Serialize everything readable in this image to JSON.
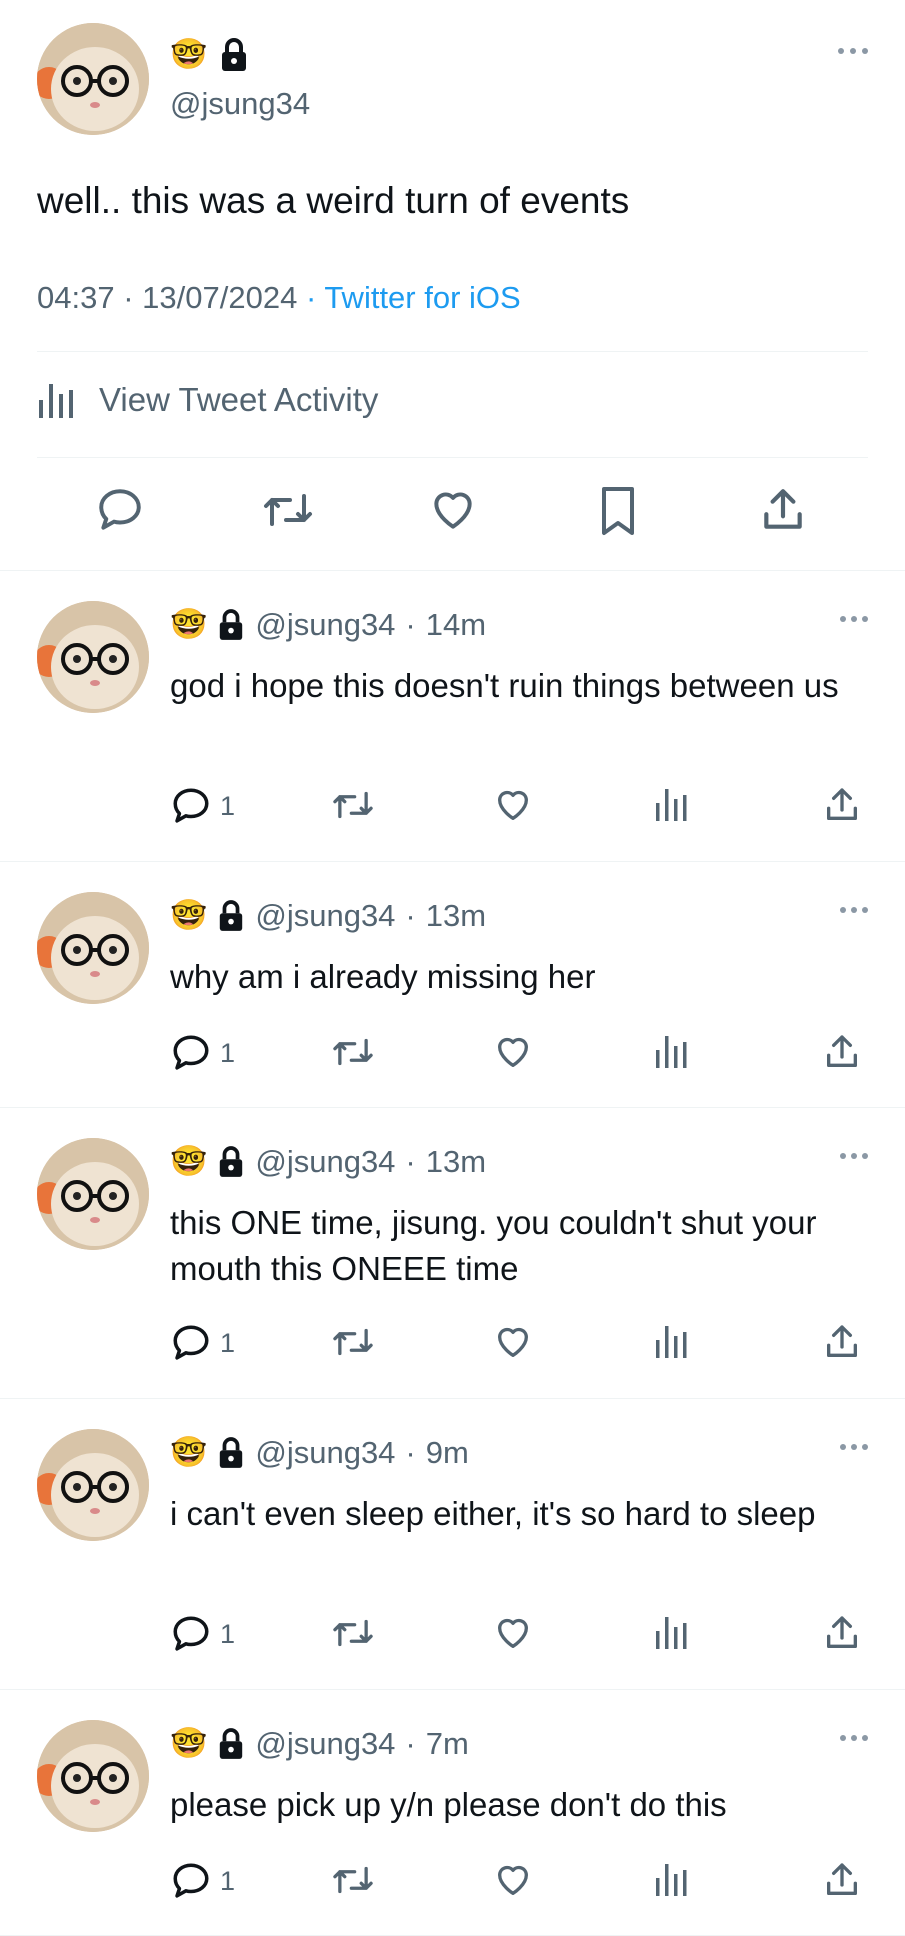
{
  "main_tweet": {
    "badges": [
      "🤓",
      "🔒"
    ],
    "handle": "@jsung34",
    "text": "well.. this was a weird turn of events",
    "time": "04:37",
    "date": "13/07/2024",
    "source": "Twitter for iOS",
    "activity_label": "View Tweet Activity"
  },
  "replies": [
    {
      "handle": "@jsung34",
      "time": "14m",
      "text": "god i hope this doesn't ruin things between us",
      "reply_count": "1"
    },
    {
      "handle": "@jsung34",
      "time": "13m",
      "text": "why am i already missing her",
      "reply_count": "1"
    },
    {
      "handle": "@jsung34",
      "time": "13m",
      "text": "this ONE time, jisung. you couldn't shut your mouth this ONEEE time",
      "reply_count": "1"
    },
    {
      "handle": "@jsung34",
      "time": "9m",
      "text": "i can't even sleep either, it's so hard to sleep",
      "reply_count": "1"
    },
    {
      "handle": "@jsung34",
      "time": "7m",
      "text": "please pick up y/n please don't do this",
      "reply_count": "1"
    }
  ],
  "separator": "·",
  "colors": {
    "accent": "#1d9bf0",
    "muted": "#536471",
    "divider": "#eff3f4"
  },
  "icons": [
    "reply-icon",
    "retweet-icon",
    "like-icon",
    "bookmark-icon",
    "share-icon",
    "analytics-icon",
    "more-icon",
    "lock-icon"
  ]
}
